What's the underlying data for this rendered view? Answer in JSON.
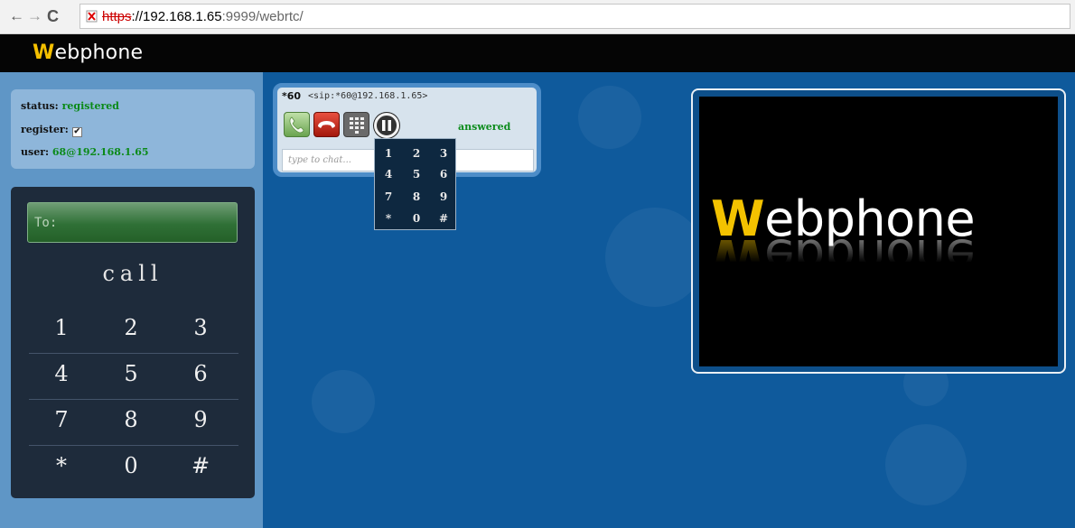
{
  "browser": {
    "url_scheme": "https",
    "url_host": "://192.168.1.65",
    "url_rest": ":9999/webrtc/"
  },
  "header": {
    "brand_first": "W",
    "brand_rest": "ebphone"
  },
  "status": {
    "status_label": "status:",
    "status_value": "registered",
    "register_label": "register:",
    "register_checked": "✔",
    "user_label": "user:",
    "user_value": "68@192.168.1.65"
  },
  "dialer": {
    "to_placeholder": "To:",
    "call_label": "call",
    "keys": [
      [
        "1",
        "2",
        "3"
      ],
      [
        "4",
        "5",
        "6"
      ],
      [
        "7",
        "8",
        "9"
      ],
      [
        "*",
        "0",
        "#"
      ]
    ]
  },
  "call": {
    "number": "*60",
    "sip": "<sip:*60@192.168.1.65>",
    "state": "answered",
    "chat_placeholder": "type to chat...",
    "mini_keys": [
      [
        "1",
        "2",
        "3"
      ],
      [
        "4",
        "5",
        "6"
      ],
      [
        "7",
        "8",
        "9"
      ],
      [
        "*",
        "0",
        "#"
      ]
    ]
  },
  "video": {
    "logo_first": "W",
    "logo_rest": "ebphone"
  },
  "colors": {
    "page_bg": "#0f5a9c",
    "brand_accent": "#f5c000",
    "status_green": "#0b8a19"
  }
}
